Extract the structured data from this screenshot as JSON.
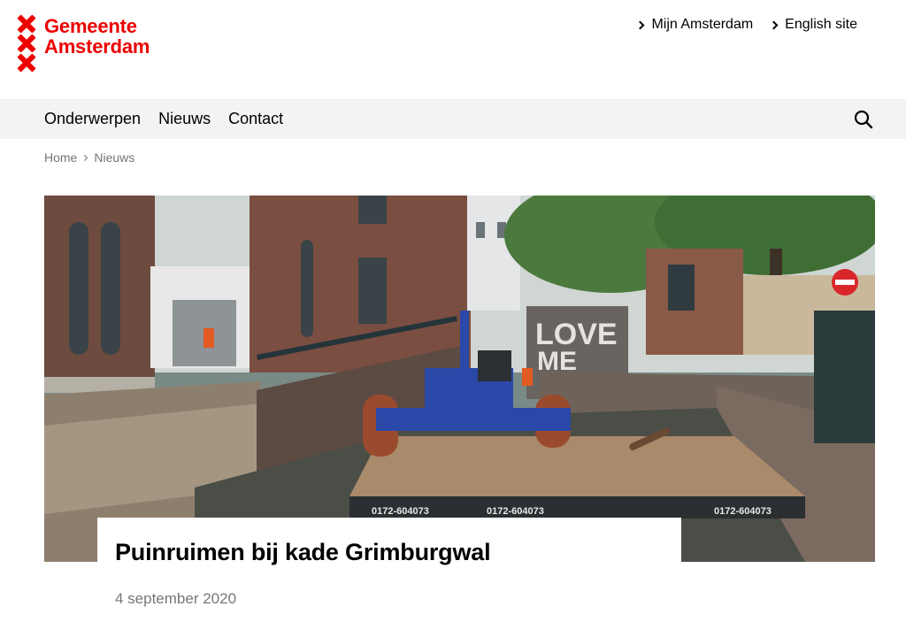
{
  "header": {
    "logo_line1": "Gemeente",
    "logo_line2": "Amsterdam",
    "links": [
      {
        "label": "Mijn Amsterdam"
      },
      {
        "label": "English site"
      }
    ]
  },
  "nav": {
    "items": [
      {
        "label": "Onderwerpen"
      },
      {
        "label": "Nieuws"
      },
      {
        "label": "Contact"
      }
    ],
    "search_icon": "search-icon"
  },
  "breadcrumb": {
    "items": [
      "Home",
      "Nieuws"
    ]
  },
  "hero": {
    "wall_text_1": "LOVE",
    "wall_text_2": "ME",
    "pontoon_code": "0172-604073"
  },
  "article": {
    "title": "Puinruimen bij kade Grimburgwal",
    "date": "4 september 2020"
  },
  "colors": {
    "brand_red": "#ec0000",
    "nav_bg": "#f3f3f3",
    "muted_text": "#767676"
  }
}
